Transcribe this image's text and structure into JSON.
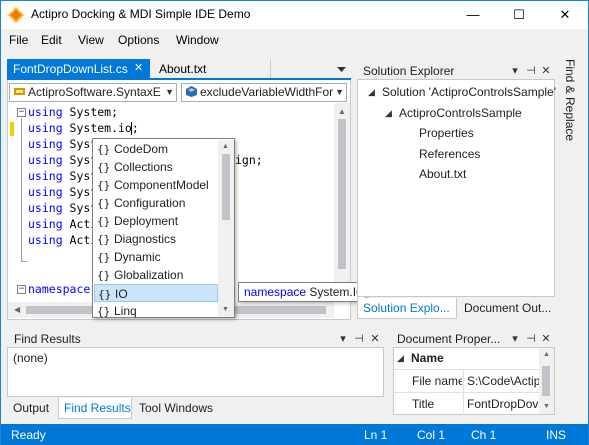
{
  "window": {
    "title": "Actipro Docking & MDI Simple IDE Demo",
    "accent": "#0078d7",
    "caption_minimize": "—",
    "caption_maximize": "☐",
    "caption_close": "✕"
  },
  "menu": [
    "File",
    "Edit",
    "View",
    "Options",
    "Window"
  ],
  "doc_tabs": {
    "active": "FontDropDownList.cs",
    "active_close": "✕",
    "inactive": "About.txt",
    "overflow_icon": "chevron-down-icon"
  },
  "editor": {
    "type_combo": "ActiproSoftware.SyntaxE",
    "member_combo": "excludeVariableWidthFor",
    "lines": [
      {
        "kw": "using",
        "rest": " System;"
      },
      {
        "kw": "using",
        "rest": " System.io;"
      },
      {
        "kw": "using",
        "rest": " Syst"
      },
      {
        "kw": "using",
        "rest": " Syst"
      },
      {
        "kw": "using",
        "rest": " Syst"
      },
      {
        "kw": "using",
        "rest": " Syst"
      },
      {
        "kw": "using",
        "rest": " Syst"
      },
      {
        "kw": "using",
        "rest": " Acti"
      },
      {
        "kw": "using",
        "rest": " Acti"
      }
    ],
    "line4_tail": "ign;",
    "namespace_kw": "namespace"
  },
  "completion": {
    "items": [
      "CodeDom",
      "Collections",
      "ComponentModel",
      "Configuration",
      "Deployment",
      "Diagnostics",
      "Dynamic",
      "Globalization",
      "IO",
      "Linq"
    ],
    "selected": "IO",
    "icon_glyph": "{}"
  },
  "tooltip": {
    "kw": "namespace",
    "rest": " System.IO"
  },
  "solution_explorer": {
    "title": "Solution Explorer",
    "items": [
      {
        "label": "Solution 'ActiproControlsSample'"
      },
      {
        "label": "ActiproControlsSample"
      },
      {
        "label": "Properties"
      },
      {
        "label": "References"
      },
      {
        "label": "About.txt"
      }
    ],
    "tabs": [
      "Solution Explo...",
      "Document Out..."
    ]
  },
  "side_tab": "Find & Replace",
  "find_results": {
    "title": "Find Results",
    "content": "(none)",
    "tabs": [
      "Output",
      "Find Results",
      "Tool Windows"
    ]
  },
  "doc_properties": {
    "title": "Document Proper...",
    "header": "Name",
    "rows": [
      {
        "name": "File name",
        "value": "S:\\Code\\Actip"
      },
      {
        "name": "Title",
        "value": "FontDropDov"
      }
    ]
  },
  "status": {
    "state": "Ready",
    "ln": "Ln 1",
    "col": "Col 1",
    "ch": "Ch 1",
    "mode": "INS"
  },
  "panel_buttons": {
    "dropdown": "▾",
    "pin": "⊣",
    "close": "✕"
  }
}
